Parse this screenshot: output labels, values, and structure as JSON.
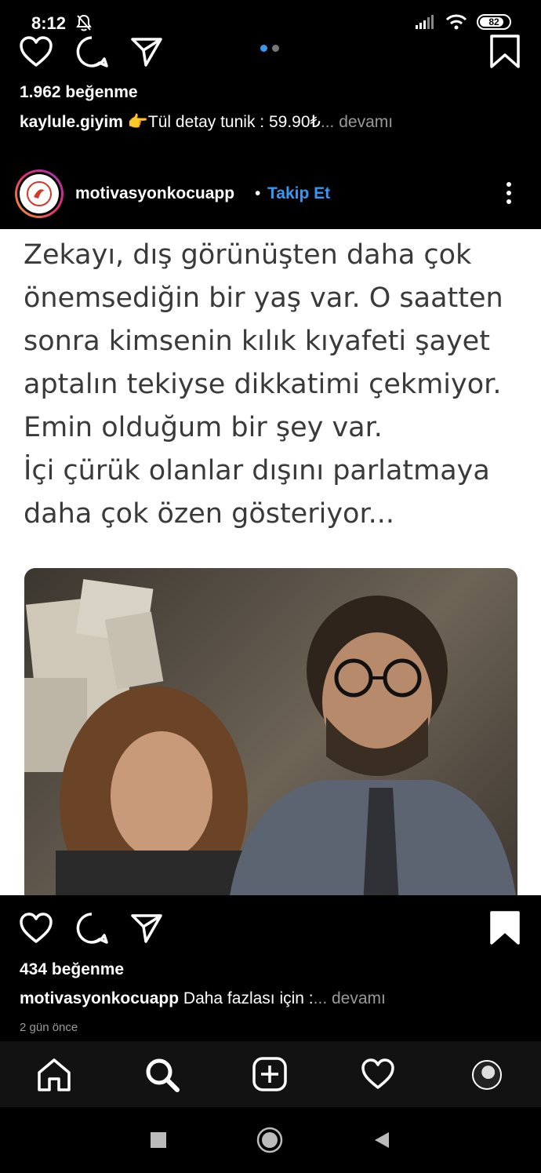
{
  "status_bar": {
    "time": "8:12",
    "battery": "82",
    "battery_level": 0.82
  },
  "post1": {
    "likes": "1.962 beğenme",
    "caption_user": "kaylule.giyim",
    "caption_text": " 👉Tül detay tunik : 59.90₺",
    "more_label": "... devamı",
    "carousel_count": 2,
    "carousel_active": 1
  },
  "post2": {
    "username": "motivasyonkocuapp",
    "separator": "•",
    "follow_label": "Takip Et",
    "quote_lines": [
      "Zekayı, dış görünüşten daha çok",
      "önemsediğin bir yaş var. O saatten",
      "sonra kimsenin kılık kıyafeti şayet",
      "aptalın tekiyse dikkatimi çekmiyor.",
      "Emin olduğum bir şey var.",
      "İçi çürük olanlar dışını parlatmaya",
      "daha çok özen gösteriyor..."
    ],
    "likes": "434 beğenme",
    "caption_user": "motivasyonkocuapp",
    "caption_text": " Daha fazlası için :",
    "more_label": "... devamı",
    "time_ago": "2 gün önce"
  },
  "bottom_nav": [
    "home-icon",
    "search-icon",
    "add-post-icon",
    "activity-heart-icon",
    "profile-avatar"
  ],
  "system_nav": [
    "recent-apps-icon",
    "home-circle-icon",
    "back-icon"
  ],
  "colors": {
    "accent": "#3897f0",
    "background": "#000000",
    "nav_bg": "#121212"
  }
}
